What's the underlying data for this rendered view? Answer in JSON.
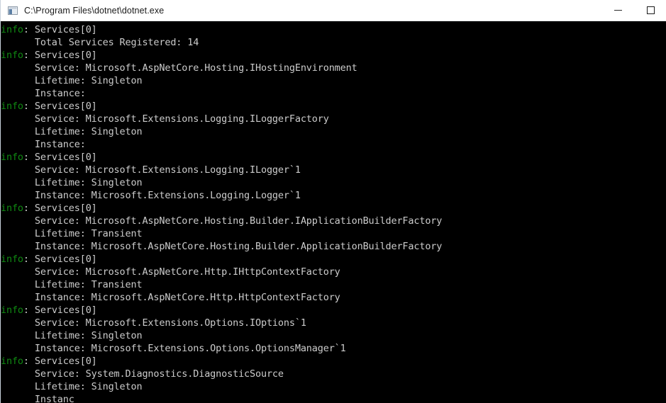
{
  "window": {
    "title": "C:\\Program Files\\dotnet\\dotnet.exe",
    "icon": "console-window-icon",
    "controls": {
      "minimize_label": "—",
      "maximize_label": "□"
    },
    "colors": {
      "titlebar_background": "#ffffff",
      "title_text": "#1a1a1a",
      "console_background": "#000000",
      "console_text": "#cccccc",
      "log_level_info": "#0f8a12",
      "window_border": "#c9d2dc"
    }
  },
  "console": {
    "log_level_label": "info",
    "category_label": "Services[0]",
    "lines": [
      {
        "type": "header",
        "level": "info",
        "separator": ": ",
        "text": "Services[0]"
      },
      {
        "type": "detail",
        "text": "      Total Services Registered: 14"
      },
      {
        "type": "header",
        "level": "info",
        "separator": ": ",
        "text": "Services[0]"
      },
      {
        "type": "detail",
        "text": "      Service: Microsoft.AspNetCore.Hosting.IHostingEnvironment"
      },
      {
        "type": "detail",
        "text": "      Lifetime: Singleton"
      },
      {
        "type": "detail",
        "text": "      Instance: "
      },
      {
        "type": "header",
        "level": "info",
        "separator": ": ",
        "text": "Services[0]"
      },
      {
        "type": "detail",
        "text": "      Service: Microsoft.Extensions.Logging.ILoggerFactory"
      },
      {
        "type": "detail",
        "text": "      Lifetime: Singleton"
      },
      {
        "type": "detail",
        "text": "      Instance: "
      },
      {
        "type": "header",
        "level": "info",
        "separator": ": ",
        "text": "Services[0]"
      },
      {
        "type": "detail",
        "text": "      Service: Microsoft.Extensions.Logging.ILogger`1"
      },
      {
        "type": "detail",
        "text": "      Lifetime: Singleton"
      },
      {
        "type": "detail",
        "text": "      Instance: Microsoft.Extensions.Logging.Logger`1"
      },
      {
        "type": "header",
        "level": "info",
        "separator": ": ",
        "text": "Services[0]"
      },
      {
        "type": "detail",
        "text": "      Service: Microsoft.AspNetCore.Hosting.Builder.IApplicationBuilderFactory"
      },
      {
        "type": "detail",
        "text": "      Lifetime: Transient"
      },
      {
        "type": "detail",
        "text": "      Instance: Microsoft.AspNetCore.Hosting.Builder.ApplicationBuilderFactory"
      },
      {
        "type": "header",
        "level": "info",
        "separator": ": ",
        "text": "Services[0]"
      },
      {
        "type": "detail",
        "text": "      Service: Microsoft.AspNetCore.Http.IHttpContextFactory"
      },
      {
        "type": "detail",
        "text": "      Lifetime: Transient"
      },
      {
        "type": "detail",
        "text": "      Instance: Microsoft.AspNetCore.Http.HttpContextFactory"
      },
      {
        "type": "header",
        "level": "info",
        "separator": ": ",
        "text": "Services[0]"
      },
      {
        "type": "detail",
        "text": "      Service: Microsoft.Extensions.Options.IOptions`1"
      },
      {
        "type": "detail",
        "text": "      Lifetime: Singleton"
      },
      {
        "type": "detail",
        "text": "      Instance: Microsoft.Extensions.Options.OptionsManager`1"
      },
      {
        "type": "header",
        "level": "info",
        "separator": ": ",
        "text": "Services[0]"
      },
      {
        "type": "detail",
        "text": "      Service: System.Diagnostics.DiagnosticSource"
      },
      {
        "type": "detail",
        "text": "      Lifetime: Singleton"
      },
      {
        "type": "detail",
        "text": "      Instanc"
      }
    ]
  }
}
